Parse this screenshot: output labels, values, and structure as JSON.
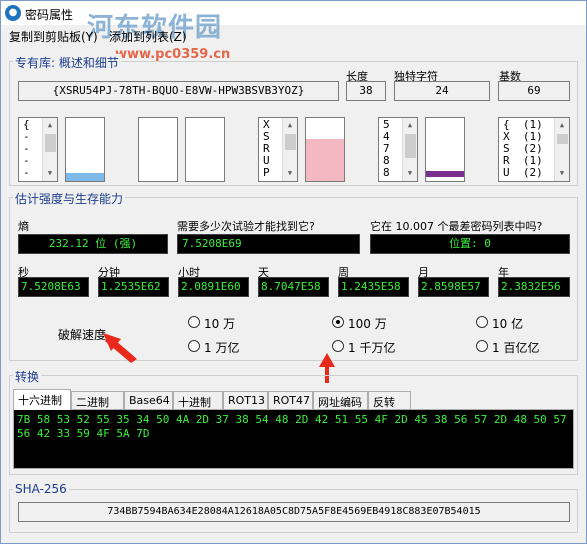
{
  "window": {
    "title": "密码属性"
  },
  "watermark": {
    "text": "河东软件园",
    "url": "www.pc0359.cn"
  },
  "menu": [
    {
      "label": "复制到剪贴板(Y)"
    },
    {
      "label": "添加到列表(Z)"
    }
  ],
  "summary": {
    "group_label": "专有库:",
    "tab_label": "概述和细节",
    "length_label": "长度",
    "unique_label": "独特字符",
    "base_label": "基数",
    "password": "{XSRU54PJ-78TH-BQUO-E8VW-HPW3BSVB3YOZ}",
    "length": "38",
    "unique": "24",
    "base": "69",
    "list1": [
      "{",
      "-",
      "-",
      "-",
      "-"
    ],
    "list2": [
      "X",
      "S",
      "R",
      "U",
      "P"
    ],
    "list3": [
      "5",
      "4",
      "7",
      "8",
      "8"
    ],
    "list4": [
      "{  (1)",
      "X  (1)",
      "S  (2)",
      "R  (1)",
      "U  (2)"
    ]
  },
  "strength": {
    "group_label": "估计强度与生存能力",
    "entropy_label": "熵",
    "entropy_value": "232.12 位 (强)",
    "tries_label": "需要多少次试验才能找到它?",
    "tries_value": "7.5208E69",
    "worst_label": "它在 10.007 个最差密码列表中吗?",
    "worst_value": "位置: 0",
    "units": [
      {
        "label": "秒",
        "value": "7.5208E63"
      },
      {
        "label": "分钟",
        "value": "1.2535E62"
      },
      {
        "label": "小时",
        "value": "2.0891E60"
      },
      {
        "label": "天",
        "value": "8.7047E58"
      },
      {
        "label": "周",
        "value": "1.2435E58"
      },
      {
        "label": "月",
        "value": "2.8598E57"
      },
      {
        "label": "年",
        "value": "2.3832E56"
      }
    ],
    "speed_label": "破解速度",
    "speeds": [
      {
        "label": "10 万",
        "selected": false
      },
      {
        "label": "100 万",
        "selected": true
      },
      {
        "label": "10 亿",
        "selected": false
      },
      {
        "label": "1 万亿",
        "selected": false
      },
      {
        "label": "1 千万亿",
        "selected": false
      },
      {
        "label": "1 百亿亿",
        "selected": false
      }
    ]
  },
  "convert": {
    "group_label": "转换",
    "tabs": [
      "十六进制",
      "二进制",
      "Base64",
      "十进制",
      "ROT13",
      "ROT47",
      "网址编码",
      "反转"
    ],
    "active_tab": "十六进制",
    "hex_line1": "7B 58 53 52 55 35 34 50 4A 2D 37 38 54 48 2D 42 51 55 4F 2D 45 38 56 57 2D 48 50 57 33 42 53",
    "hex_line2": "56 42 33 59 4F 5A 7D"
  },
  "sha": {
    "group_label": "SHA-256",
    "value": "734BB7594BA634E28084A12618A05C8D75A5F8E4569EB4918C883E07B54015"
  },
  "colors": {
    "accent_text": "#1c3c8c",
    "display_text": "#3cf03c",
    "display_bg": "#000000",
    "annotation_arrow": "#e8291c"
  }
}
